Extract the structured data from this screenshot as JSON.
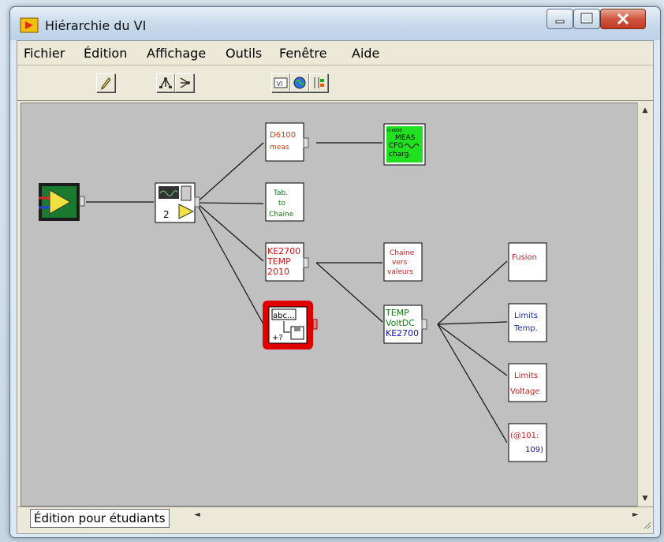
{
  "window": {
    "title": "Hiérarchie du VI",
    "controls": [
      "minimize-icon",
      "maximize-icon",
      "close-icon"
    ]
  },
  "menu": [
    {
      "label": "Fichier",
      "mnemonic": "F"
    },
    {
      "label": "Édition",
      "mnemonic": "d"
    },
    {
      "label": "Affichage",
      "mnemonic": "h"
    },
    {
      "label": "Outils",
      "mnemonic": "O"
    },
    {
      "label": "Fenêtre",
      "mnemonic": "n"
    },
    {
      "label": "Aide",
      "mnemonic": "A"
    }
  ],
  "toolbar": {
    "buttons": [
      {
        "icon": "pencil-icon"
      },
      {
        "icon": "tree-vertical-icon"
      },
      {
        "icon": "tree-horizontal-icon"
      },
      {
        "icon": "vi-icon"
      },
      {
        "icon": "globe-icon"
      },
      {
        "icon": "block-diagram-icon"
      }
    ]
  },
  "nodes": {
    "root": {
      "icon": "vi-root-icon"
    },
    "level1": {
      "icon": "acquisition-vi-icon",
      "label": "2"
    },
    "d6100": {
      "lines": [
        "D6100",
        "meas"
      ],
      "color": "#d04010"
    },
    "tab_chaine": {
      "lines": [
        "Tab.",
        "to",
        "Chaine"
      ],
      "color": "#108010"
    },
    "ke2700": {
      "lines": [
        "KE2700",
        "TEMP",
        "2010"
      ],
      "color": "#e01010"
    },
    "file_write": {
      "icon": "write-file-icon",
      "lines": [
        "abc..."
      ],
      "accent": "#e00000"
    },
    "meas_cfg": {
      "lines": [
        "D-6000",
        "MEAS",
        "CFG",
        "charg."
      ],
      "bg": "#20e020"
    },
    "chaine_vers": {
      "lines": [
        "Chaine",
        "vers",
        "valeurs"
      ],
      "color": "#d02020"
    },
    "temp_volt": {
      "lines": [
        "TEMP",
        "VoltDC",
        "KE2700"
      ],
      "colors": [
        "#108010",
        "#108010",
        "#1010c0"
      ]
    },
    "fusion": {
      "lines": [
        "Fusion"
      ],
      "color": "#d02020"
    },
    "limits_temp": {
      "lines": [
        "Limits",
        "Temp."
      ],
      "color": "#1030c0"
    },
    "limits_voltage": {
      "lines": [
        "Limits",
        "Voltage"
      ],
      "color": "#d02020"
    },
    "range": {
      "lines": [
        "(@101:",
        "109)"
      ],
      "colors": [
        "#d02020",
        "#1010a0"
      ]
    }
  },
  "status": {
    "label": "Édition pour étudiants",
    "scroll_left": "◄",
    "scroll_right": "►"
  },
  "scrollbar": {
    "up": "▲",
    "down": "▼"
  }
}
